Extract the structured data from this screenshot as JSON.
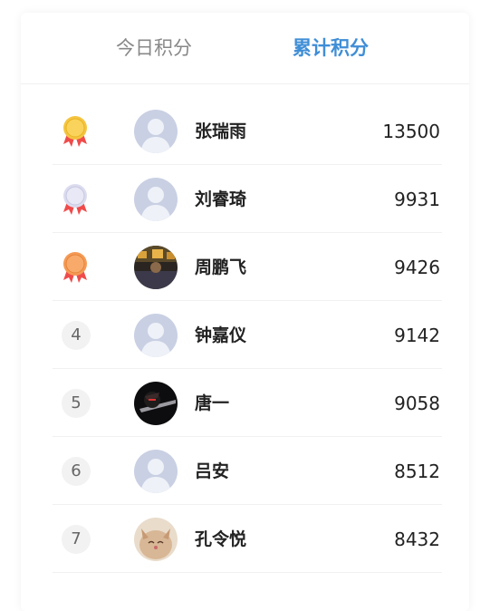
{
  "tabs": {
    "daily": "今日积分",
    "total": "累计积分"
  },
  "active_tab": "total",
  "colors": {
    "active_tab": "#3f8ed6",
    "inactive_tab": "#888888",
    "gold": "#f5c542",
    "silver": "#dcdcf0",
    "bronze": "#f59a55",
    "ribbon": "#ef4b4b"
  },
  "ranking": [
    {
      "rank": "1",
      "medal": "gold-medal-icon",
      "avatar": "default-avatar",
      "name": "张瑞雨",
      "score": "13500"
    },
    {
      "rank": "2",
      "medal": "silver-medal-icon",
      "avatar": "default-avatar",
      "name": "刘睿琦",
      "score": "9931"
    },
    {
      "rank": "3",
      "medal": "bronze-medal-icon",
      "avatar": "photo-avatar",
      "name": "周鹏飞",
      "score": "9426"
    },
    {
      "rank": "4",
      "medal": "",
      "avatar": "default-avatar",
      "name": "钟嘉仪",
      "score": "9142"
    },
    {
      "rank": "5",
      "medal": "",
      "avatar": "photo-avatar",
      "name": "唐一",
      "score": "9058"
    },
    {
      "rank": "6",
      "medal": "",
      "avatar": "default-avatar",
      "name": "吕安",
      "score": "8512"
    },
    {
      "rank": "7",
      "medal": "",
      "avatar": "photo-avatar",
      "name": "孔令悦",
      "score": "8432"
    }
  ]
}
